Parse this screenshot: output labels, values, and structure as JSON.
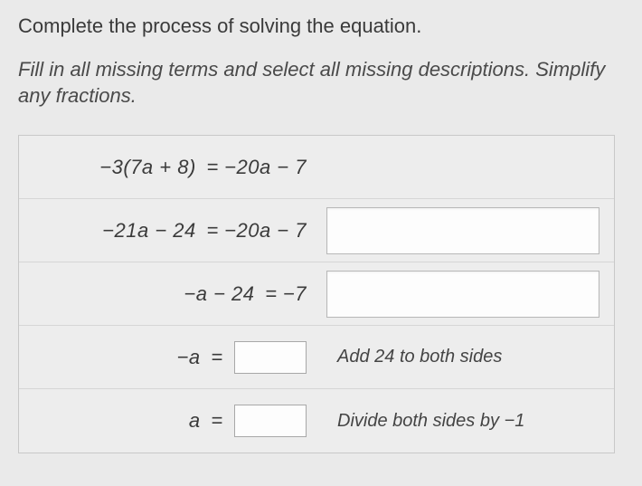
{
  "prompt": "Complete the process of solving the equation.",
  "instructions": "Fill in all missing terms and select all missing descriptions. Simplify any fractions.",
  "rows": [
    {
      "lhs": "−3(7a + 8)",
      "eq": "=",
      "rhs": "−20a − 7",
      "rhs_has_box": false,
      "desc_type": "none",
      "desc_text": ""
    },
    {
      "lhs": "−21a − 24",
      "eq": "=",
      "rhs": "−20a − 7",
      "rhs_has_box": false,
      "desc_type": "input",
      "desc_text": ""
    },
    {
      "lhs": "−a − 24",
      "eq": "=",
      "rhs": "−7",
      "rhs_has_box": false,
      "desc_type": "input",
      "desc_text": ""
    },
    {
      "lhs": "−a",
      "eq": "=",
      "rhs": "",
      "rhs_has_box": true,
      "desc_type": "label",
      "desc_text": "Add 24 to both sides"
    },
    {
      "lhs": "a",
      "eq": "=",
      "rhs": "",
      "rhs_has_box": true,
      "desc_type": "label",
      "desc_text": "Divide both sides by −1"
    }
  ]
}
